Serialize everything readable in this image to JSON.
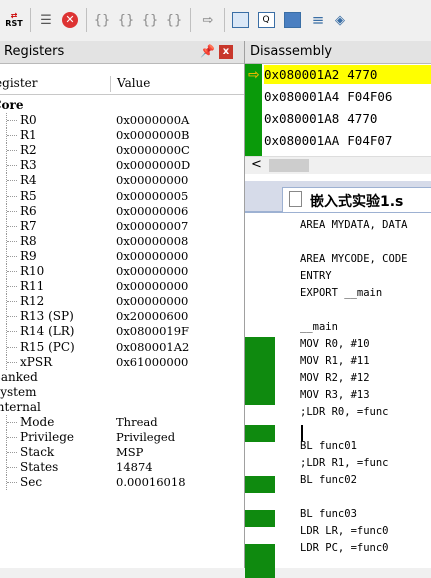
{
  "toolbar": {
    "reset_label": "RST",
    "buttons": [
      "reset-icon",
      "step-icon",
      "stop-icon",
      "step-into-icon",
      "step-over-icon",
      "step-out-icon",
      "run-to-cursor-icon",
      "show-next-icon",
      "command-window-icon",
      "disassembly-window-icon",
      "symbols-window-icon",
      "registers-window-icon",
      "call-stack-icon"
    ]
  },
  "registers": {
    "title": "Registers",
    "pin": "❑",
    "close": "x",
    "col_register": "Register",
    "col_value": "Value",
    "rows": [
      {
        "name": "Core",
        "value": "",
        "group": true
      },
      {
        "name": "R0",
        "value": "0x0000000A"
      },
      {
        "name": "R1",
        "value": "0x0000000B"
      },
      {
        "name": "R2",
        "value": "0x0000000C"
      },
      {
        "name": "R3",
        "value": "0x0000000D"
      },
      {
        "name": "R4",
        "value": "0x00000000"
      },
      {
        "name": "R5",
        "value": "0x00000005"
      },
      {
        "name": "R6",
        "value": "0x00000006"
      },
      {
        "name": "R7",
        "value": "0x00000007"
      },
      {
        "name": "R8",
        "value": "0x00000008"
      },
      {
        "name": "R9",
        "value": "0x00000000"
      },
      {
        "name": "R10",
        "value": "0x00000000"
      },
      {
        "name": "R11",
        "value": "0x00000000"
      },
      {
        "name": "R12",
        "value": "0x00000000"
      },
      {
        "name": "R13 (SP)",
        "value": "0x20000600"
      },
      {
        "name": "R14 (LR)",
        "value": "0x0800019F"
      },
      {
        "name": "R15 (PC)",
        "value": "0x080001A2"
      },
      {
        "name": "xPSR",
        "value": "0x61000000"
      },
      {
        "name": "Banked",
        "value": "",
        "group": true
      },
      {
        "name": "System",
        "value": "",
        "group": true
      },
      {
        "name": "Internal",
        "value": "",
        "group": true
      },
      {
        "name": "Mode",
        "value": "Thread"
      },
      {
        "name": "Privilege",
        "value": "Privileged"
      },
      {
        "name": "Stack",
        "value": "MSP"
      },
      {
        "name": "States",
        "value": "14874"
      },
      {
        "name": "Sec",
        "value": "0.00016018"
      }
    ]
  },
  "disassembly": {
    "title": "Disassembly",
    "lines": [
      {
        "addr": "0x080001A2",
        "code": "4770",
        "current": true
      },
      {
        "addr": "0x080001A4",
        "code": "F04F06"
      },
      {
        "addr": "0x080001A8",
        "code": "4770"
      },
      {
        "addr": "0x080001AA",
        "code": "F04F07"
      }
    ],
    "scroll_left": "<"
  },
  "editor": {
    "tab_label": "嵌入式实验1.s",
    "lines": [
      "AREA MYDATA, DATA",
      "",
      "AREA MYCODE, CODE",
      "   ENTRY",
      "   EXPORT __main",
      "",
      "__main",
      "   MOV R0, #10",
      "   MOV R1, #11",
      "   MOV R2, #12",
      "   MOV R3, #13",
      "   ;LDR R0, =func",
      "",
      "   BL  func01",
      "   ;LDR R1, =func",
      "   BL  func02",
      "",
      "   BL  func03",
      "   LDR LR, =func0",
      "   LDR PC, =func0"
    ]
  },
  "colors": {
    "accent_green": "#0a9a0a",
    "highlight_yellow": "#ffff00",
    "close_red": "#c8372b"
  }
}
